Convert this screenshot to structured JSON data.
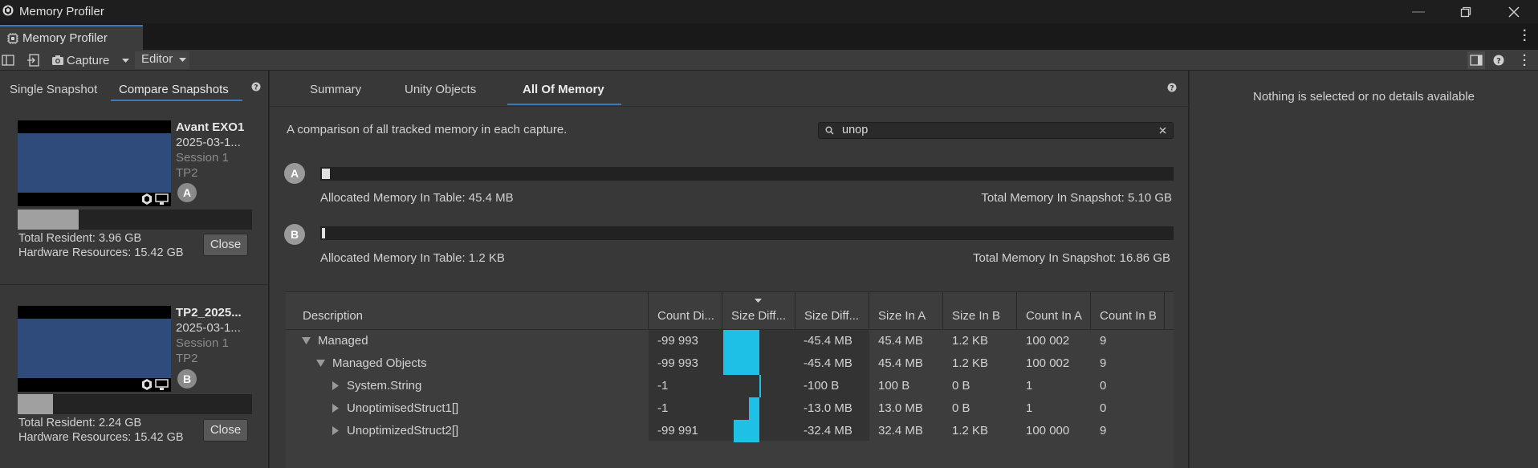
{
  "window": {
    "title": "Memory Profiler"
  },
  "tab": {
    "label": "Memory Profiler"
  },
  "toolbar": {
    "capture_label": "Capture",
    "editor_label": "Editor"
  },
  "left": {
    "modes": [
      "Single Snapshot",
      "Compare Snapshots"
    ],
    "snapshots": [
      {
        "name": "Avant EXO1",
        "date": "2025-03-1...",
        "session": "Session 1",
        "platform": "TP2",
        "badge": "A",
        "progress": 0.26,
        "resident": "Total Resident: 3.96 GB",
        "hardware": "Hardware Resources: 15.42 GB",
        "close": "Close"
      },
      {
        "name": "TP2_2025...",
        "date": "2025-03-1...",
        "session": "Session 1",
        "platform": "TP2",
        "badge": "B",
        "progress": 0.15,
        "resident": "Total Resident: 2.24 GB",
        "hardware": "Hardware Resources: 15.42 GB",
        "close": "Close"
      }
    ]
  },
  "main": {
    "tabs": [
      "Summary",
      "Unity Objects",
      "All Of Memory"
    ],
    "active_tab": "All Of Memory",
    "description": "A comparison of all tracked memory in each capture.",
    "search": {
      "value": "unop"
    },
    "captures": [
      {
        "badge": "A",
        "allocated": "Allocated Memory In Table: 45.4 MB",
        "total": "Total Memory In Snapshot: 5.10 GB",
        "fraction": 0.009
      },
      {
        "badge": "B",
        "allocated": "Allocated Memory In Table: 1.2 KB",
        "total": "Total Memory In Snapshot: 16.86 GB",
        "fraction": 0.0001
      }
    ],
    "table": {
      "columns": [
        "Description",
        "Count Di...",
        "Size Diff...",
        "Size Diff...",
        "Size In A",
        "Size In B",
        "Count In A",
        "Count In B"
      ],
      "rows": [
        {
          "desc": "Managed",
          "level": 0,
          "expanded": true,
          "count_diff": "-99 993",
          "bar_start": 0.0,
          "bar_end": 1.0,
          "size_diff": "-45.4 MB",
          "size_a": "45.4 MB",
          "size_b": "1.2 KB",
          "count_a": "100 002",
          "count_b": "9"
        },
        {
          "desc": "Managed Objects",
          "level": 1,
          "expanded": true,
          "count_diff": "-99 993",
          "bar_start": 0.0,
          "bar_end": 1.0,
          "size_diff": "-45.4 MB",
          "size_a": "45.4 MB",
          "size_b": "1.2 KB",
          "count_a": "100 002",
          "count_b": "9"
        },
        {
          "desc": "System.String",
          "level": 2,
          "expanded": false,
          "count_diff": "-1",
          "bar_start": 0.99,
          "bar_end": 1.0,
          "size_diff": "-100 B",
          "size_a": "100 B",
          "size_b": "0 B",
          "count_a": "1",
          "count_b": "0"
        },
        {
          "desc": "UnoptimisedStruct1[]",
          "level": 2,
          "expanded": false,
          "count_diff": "-1",
          "bar_start": 0.71,
          "bar_end": 1.0,
          "size_diff": "-13.0 MB",
          "size_a": "13.0 MB",
          "size_b": "0 B",
          "count_a": "1",
          "count_b": "0"
        },
        {
          "desc": "UnoptimizedStruct2[]",
          "level": 2,
          "expanded": false,
          "count_diff": "-99 991",
          "bar_start": 0.29,
          "bar_end": 1.0,
          "size_diff": "-32.4 MB",
          "size_a": "32.4 MB",
          "size_b": "1.2 KB",
          "count_a": "100 000",
          "count_b": "9"
        }
      ]
    }
  },
  "details": {
    "empty_text": "Nothing is selected or no details available"
  },
  "colors": {
    "accent": "#3a79bb",
    "bar": "#1fc0e6"
  }
}
